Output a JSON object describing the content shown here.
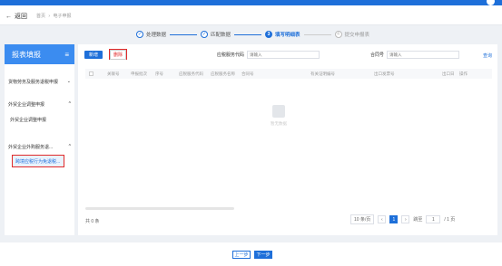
{
  "nav": {
    "back": "返回",
    "breadcrumb": [
      "首页",
      "电子申报"
    ]
  },
  "steps": [
    {
      "num": "✓",
      "label": "处理数据",
      "state": "done"
    },
    {
      "num": "✓",
      "label": "匹配数据",
      "state": "done"
    },
    {
      "num": "3",
      "label": "填写明细表",
      "state": "active"
    },
    {
      "num": "4",
      "label": "提交申报表",
      "state": "todo"
    }
  ],
  "sidebar": {
    "title": "报表填报",
    "items": [
      {
        "label": "货物劳务及服务退税申报"
      },
      {
        "label": "外贸企业调整申报"
      },
      {
        "label": "外贸企业调整申报"
      },
      {
        "label": "外贸企业外购服务退..."
      },
      {
        "label": "跨境应税行为免退税..."
      }
    ]
  },
  "toolbar": {
    "new": "新增",
    "delete": "删除"
  },
  "filters": {
    "code_label": "应税服务代码",
    "code_ph": "请输入",
    "contract_label": "合同号",
    "contract_ph": "请输入",
    "query": "查询"
  },
  "table": {
    "headers": [
      "关联号",
      "申报批次",
      "序号",
      "应税服务代码",
      "应税服务名称",
      "合同号",
      "有关证明编号",
      "出口发票号",
      "出口日",
      "操作"
    ]
  },
  "empty_text": "暂无数据",
  "pagination": {
    "total": "共 0 条",
    "page_size": "10 条/页",
    "current_page": "1",
    "goto_label": "跳至",
    "goto_value": "1",
    "total_pages": "/ 1 页"
  },
  "footer": {
    "prev": "上一步",
    "next": "下一步"
  },
  "colors": {
    "accent": "#1e6fd9",
    "highlight": "#e12a2a"
  }
}
